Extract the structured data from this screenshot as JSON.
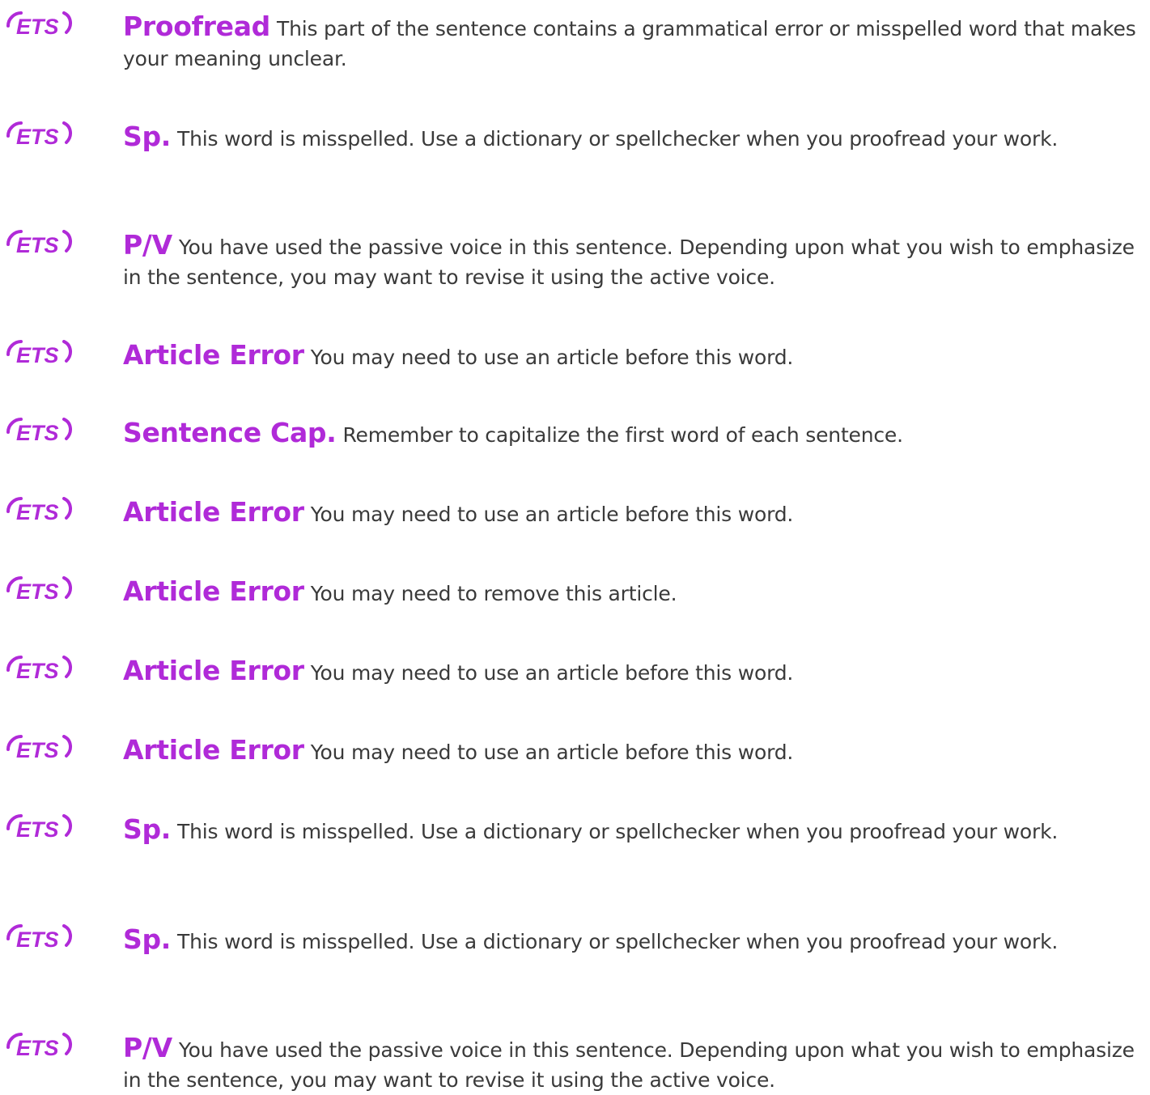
{
  "logo_text": "ETS",
  "colors": {
    "accent": "#b02ad8",
    "text": "#3a3a3a"
  },
  "items": [
    {
      "label": "Proofread",
      "desc": "This part of the sentence contains a grammatical error or misspelled word that makes your meaning unclear."
    },
    {
      "label": "Sp.",
      "desc": "This word is misspelled. Use a dictionary or spellchecker when you proofread your work."
    },
    {
      "label": "P/V",
      "desc": "You have used the passive voice in this sentence. Depending upon what you wish to emphasize in the sentence, you may want to revise it using the active voice."
    },
    {
      "label": "Article Error",
      "desc": "You may need to use an article before this word."
    },
    {
      "label": "Sentence Cap.",
      "desc": "Remember to capitalize the first word of each sentence."
    },
    {
      "label": "Article Error",
      "desc": "You may need to use an article before this word."
    },
    {
      "label": "Article Error",
      "desc": "You may need to remove this article."
    },
    {
      "label": "Article Error",
      "desc": "You may need to use an article before this word."
    },
    {
      "label": "Article Error",
      "desc": "You may need to use an article before this word."
    },
    {
      "label": "Sp.",
      "desc": "This word is misspelled. Use a dictionary or spellchecker when you proofread your work."
    },
    {
      "label": "Sp.",
      "desc": "This word is misspelled. Use a dictionary or spellchecker when you proofread your work."
    },
    {
      "label": "P/V",
      "desc": "You have used the passive voice in this sentence. Depending upon what you wish to emphasize in the sentence, you may want to revise it using the active voice."
    }
  ]
}
